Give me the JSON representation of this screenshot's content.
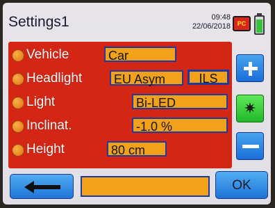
{
  "header": {
    "title": "Settings1",
    "time": "09:48",
    "date": "22/06/2018",
    "status_badge": "PC",
    "battery_level": 0.8
  },
  "settings": {
    "vehicle": {
      "label": "Vehicle",
      "value": "Car"
    },
    "headlight": {
      "label": "Headlight",
      "value": "EU Asym",
      "extra": "ILS"
    },
    "light": {
      "label": "Light",
      "value": "Bi-LED"
    },
    "inclination": {
      "label": "Inclinat.",
      "value": "-1.0 %"
    },
    "height": {
      "label": "Height",
      "value": "80 cm"
    }
  },
  "buttons": {
    "plus": "plus-icon",
    "center": "sun-star-icon",
    "minus": "minus-icon",
    "back": "return-arrow-icon",
    "ok_label": "OK"
  },
  "message": "",
  "colors": {
    "panel": "#d42614",
    "value_fill": "#f2a21a",
    "button_blue": "#1f74d6",
    "button_green": "#22b82a"
  }
}
